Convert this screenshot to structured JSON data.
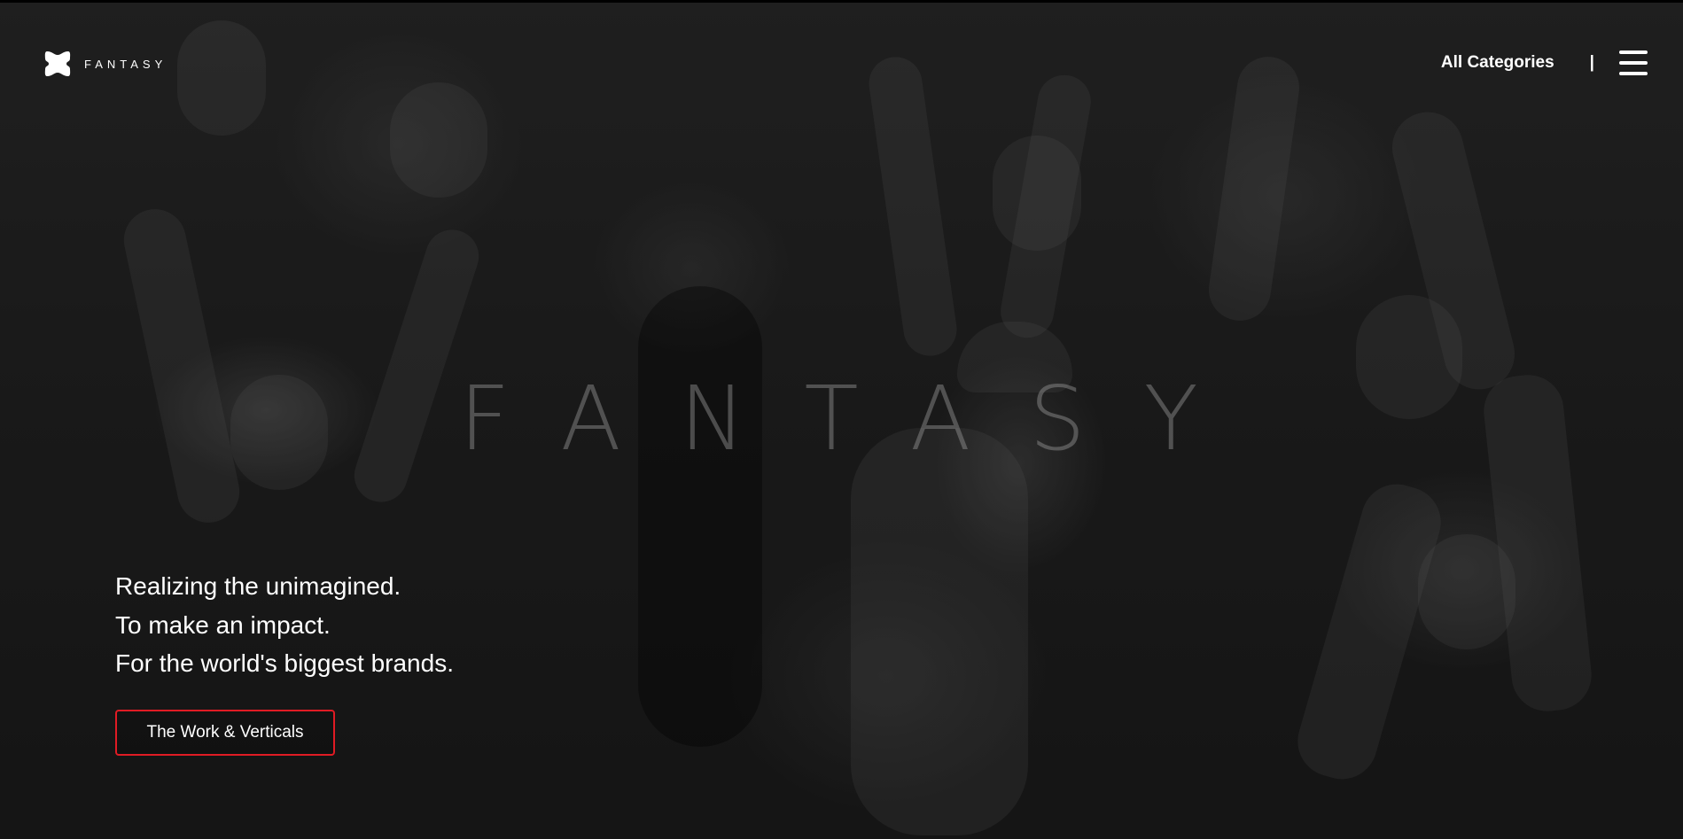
{
  "brand": {
    "logo_text": "FANTASY",
    "logo_icon": "fantasy-logo-icon",
    "watermark": "FANTASY"
  },
  "nav": {
    "categories_label": "All Categories",
    "separator": "|",
    "menu_icon": "hamburger-menu-icon"
  },
  "hero": {
    "lines": [
      "Realizing the unimagined.",
      "To make an impact.",
      "For the world's biggest brands."
    ],
    "cta_label": "The Work & Verticals"
  },
  "colors": {
    "accent": "#e01b24",
    "text": "#ffffff",
    "background": "#232323"
  }
}
